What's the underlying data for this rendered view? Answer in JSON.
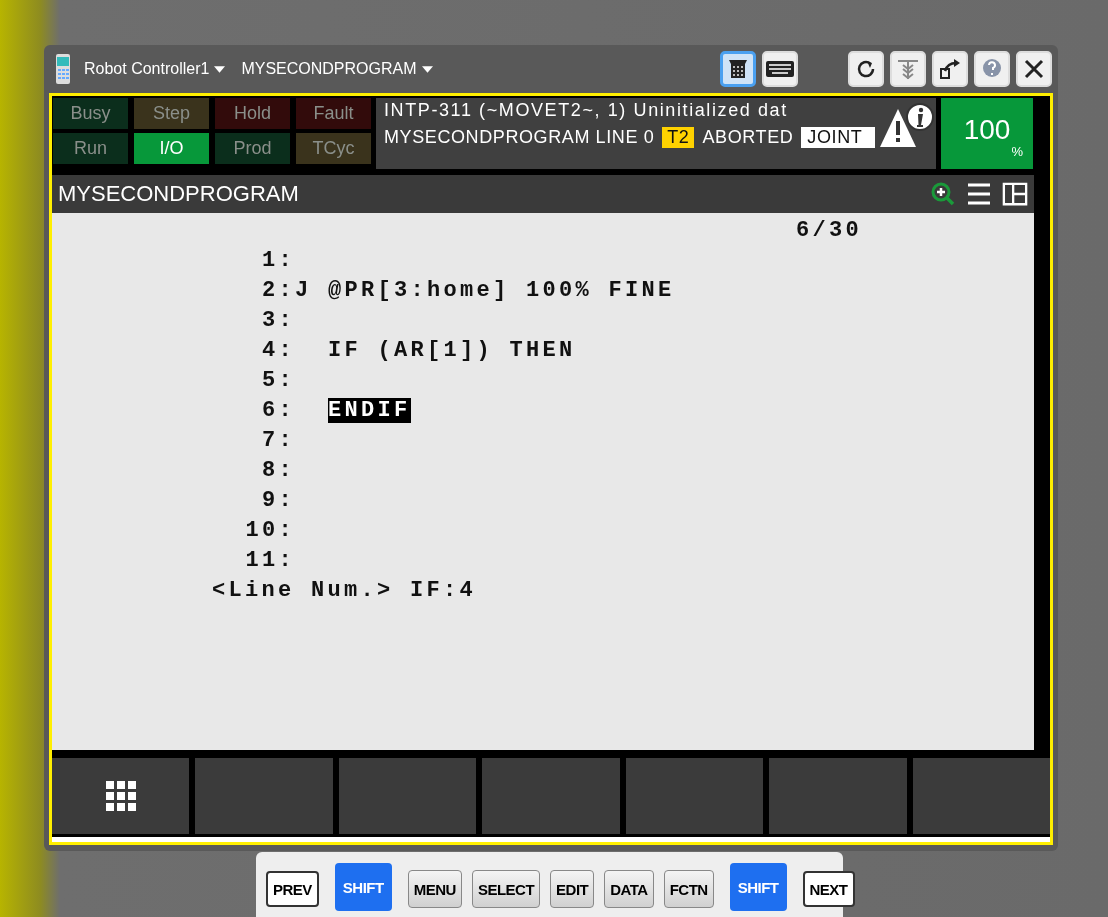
{
  "window": {
    "controller": "Robot Controller1",
    "program": "MYSECONDPROGRAM"
  },
  "toolbar": [
    {
      "kind": "pendant",
      "selected": true
    },
    {
      "kind": "keyboard",
      "selected": false
    },
    {
      "kind": "refresh",
      "selected": false
    },
    {
      "kind": "jog",
      "selected": false
    },
    {
      "kind": "export",
      "selected": false
    },
    {
      "kind": "help",
      "selected": false
    },
    {
      "kind": "close",
      "selected": false
    }
  ],
  "indicators": [
    {
      "label": "Busy",
      "kind": "green",
      "on": false
    },
    {
      "label": "Step",
      "kind": "amber",
      "on": false
    },
    {
      "label": "Hold",
      "kind": "red",
      "on": false
    },
    {
      "label": "Fault",
      "kind": "red",
      "on": false
    },
    {
      "label": "Run",
      "kind": "green",
      "on": false
    },
    {
      "label": "I/O",
      "kind": "green",
      "on": true
    },
    {
      "label": "Prod",
      "kind": "green",
      "on": false
    },
    {
      "label": "TCyc",
      "kind": "amber",
      "on": false
    }
  ],
  "status": {
    "alarm": "INTP-311 (~MOVET2~, 1) Uninitialized dat",
    "line": "MYSECONDPROGRAM LINE 0",
    "mode": "T2",
    "state": "ABORTED",
    "frame": "JOINT",
    "override": "100",
    "override_unit": "%"
  },
  "screen": {
    "title": "MYSECONDPROGRAM",
    "position": "6/30",
    "lines": [
      {
        "num": "1:"
      },
      {
        "num": "2:",
        "code": "J @PR[3:home] 100% FINE",
        "kind": "motion",
        "selected": false
      },
      {
        "num": "3:"
      },
      {
        "num": "4:",
        "code": "IF (AR[1]) THEN",
        "kind": "instruction",
        "selected": false
      },
      {
        "num": "5:"
      },
      {
        "num": "6:",
        "code": "ENDIF",
        "kind": "instruction",
        "selected": true
      },
      {
        "num": "7:"
      },
      {
        "num": "8:"
      },
      {
        "num": "9:"
      },
      {
        "num": "10:"
      },
      {
        "num": "11:"
      }
    ],
    "prompt": "<Line Num.> IF:4"
  },
  "function_keys": [
    {
      "kind": "apps"
    },
    {
      "kind": "blank"
    },
    {
      "kind": "blank"
    },
    {
      "kind": "blank"
    },
    {
      "kind": "blank"
    },
    {
      "kind": "blank"
    },
    {
      "kind": "blank"
    }
  ],
  "keys": [
    {
      "label": "PREV",
      "kind": "plain"
    },
    {
      "label": "SHIFT",
      "kind": "shift"
    },
    {
      "label": "MENU",
      "kind": "gray"
    },
    {
      "label": "SELECT",
      "kind": "gray"
    },
    {
      "label": "EDIT",
      "kind": "gray"
    },
    {
      "label": "DATA",
      "kind": "gray"
    },
    {
      "label": "FCTN",
      "kind": "gray"
    },
    {
      "label": "SHIFT",
      "kind": "shift"
    },
    {
      "label": "NEXT",
      "kind": "plain"
    }
  ]
}
